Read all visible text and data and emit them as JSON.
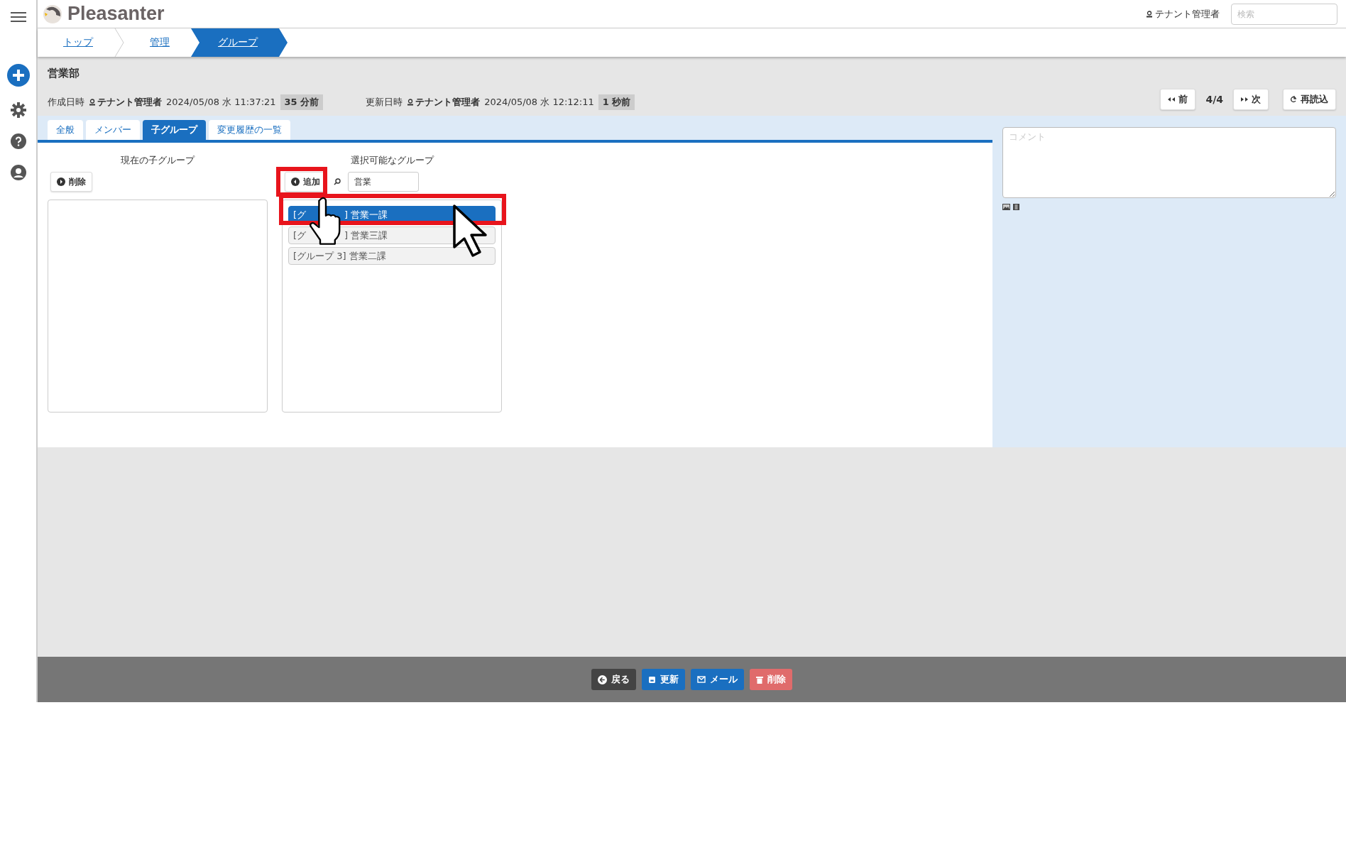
{
  "header": {
    "logo": "Pleasanter",
    "user": "テナント管理者",
    "search": {
      "placeholder": "検索"
    }
  },
  "breadcrumb": [
    {
      "label": "トップ",
      "selected": false
    },
    {
      "label": "管理",
      "selected": false
    },
    {
      "label": "グループ",
      "selected": true
    }
  ],
  "record": {
    "title": "営業部",
    "meta": [
      {
        "label": "作成日時",
        "user": "テナント管理者",
        "time": "2024/05/08 水 11:37:21",
        "ago": "35 分前"
      },
      {
        "label": "更新日時",
        "user": "テナント管理者",
        "time": "2024/05/08 水 12:12:11",
        "ago": "1 秒前"
      }
    ]
  },
  "nav": {
    "prev": "前",
    "position": "4/4",
    "next": "次",
    "reload": "再読込"
  },
  "tabs": [
    {
      "label": "全般",
      "selected": false
    },
    {
      "label": "メンバー",
      "selected": false
    },
    {
      "label": "子グループ",
      "selected": true
    },
    {
      "label": "変更履歴の一覧",
      "selected": false
    }
  ],
  "current_groups": {
    "heading": "現在の子グループ",
    "button": "削除"
  },
  "available_groups": {
    "heading": "選択可能なグループ",
    "button": "追加",
    "filter": "営業",
    "items": [
      {
        "label": "[グ",
        "label_end": "] 営業一課",
        "selected": true
      },
      {
        "label": "[グ",
        "label_end": "] 営業三課",
        "selected": false
      },
      {
        "label": "[グループ 3] 営業二課",
        "selected": false
      }
    ]
  },
  "comment": {
    "placeholder": "コメント"
  },
  "footer_buttons": [
    {
      "kind": "back",
      "label": "戻る"
    },
    {
      "kind": "update",
      "label": "更新"
    },
    {
      "kind": "mail",
      "label": "メール"
    },
    {
      "kind": "delete",
      "label": "削除"
    }
  ]
}
